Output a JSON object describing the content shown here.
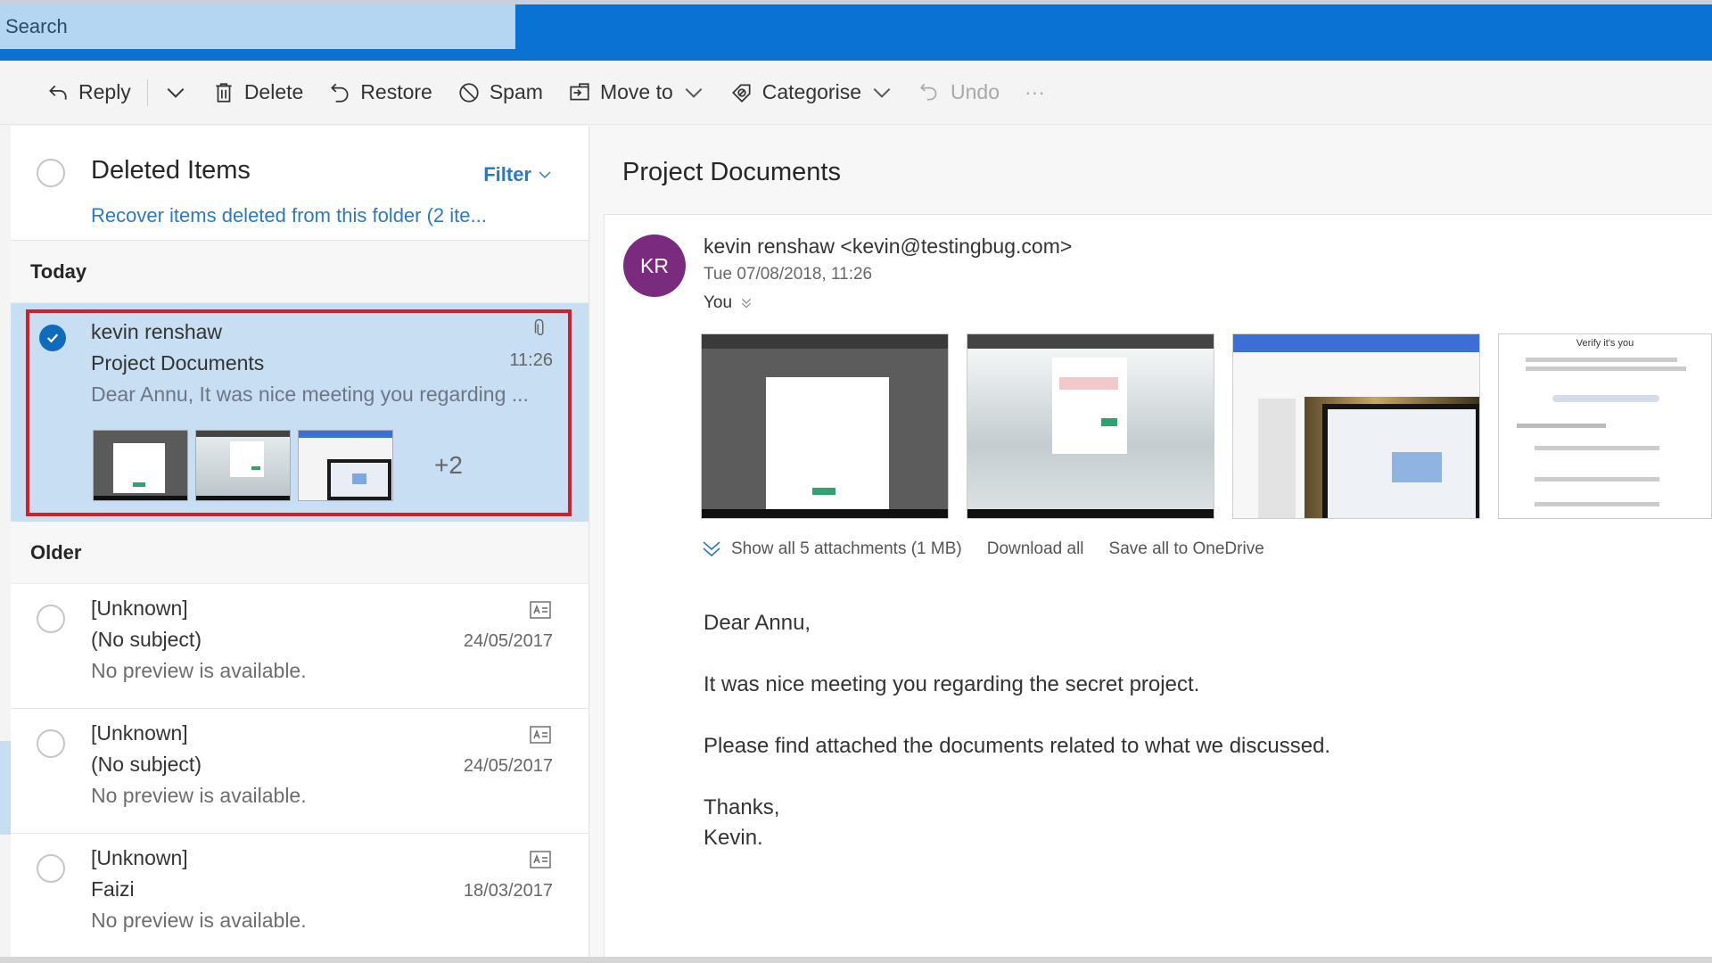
{
  "search": {
    "placeholder": "Search"
  },
  "toolbar": {
    "reply": "Reply",
    "delete": "Delete",
    "restore": "Restore",
    "spam": "Spam",
    "move_to": "Move to",
    "categorise": "Categorise",
    "undo": "Undo",
    "more": "···"
  },
  "list": {
    "folder_title": "Deleted Items",
    "filter": "Filter",
    "recover_link": "Recover items deleted from this folder (2 ite...",
    "groups": {
      "today": "Today",
      "older": "Older"
    },
    "selected": {
      "sender": "kevin renshaw",
      "subject": "Project Documents",
      "time": "11:26",
      "preview": "Dear Annu, It was nice meeting you regarding ...",
      "more_attachments": "+2",
      "has_attachment": true
    },
    "older_messages": [
      {
        "sender": "[Unknown]",
        "subject": "(No subject)",
        "date": "24/05/2017",
        "preview": "No preview is available."
      },
      {
        "sender": "[Unknown]",
        "subject": "(No subject)",
        "date": "24/05/2017",
        "preview": "No preview is available."
      },
      {
        "sender": "[Unknown]",
        "subject": "Faizi",
        "date": "18/03/2017",
        "preview": "No preview is available."
      }
    ]
  },
  "reading": {
    "title": "Project Documents",
    "avatar_initials": "KR",
    "from": "kevin renshaw <kevin@testingbug.com>",
    "date": "Tue 07/08/2018, 11:26",
    "to": "You",
    "attachments": {
      "show_all": "Show all 5 attachments (1 MB)",
      "download_all": "Download all",
      "save_all": "Save all to OneDrive",
      "thumb4_title": "Verify it's you"
    },
    "body": {
      "greeting": "Dear Annu,",
      "line1": "It was nice meeting you regarding the secret project.",
      "line2": "Please find attached the documents related to what we discussed.",
      "closing": "Thanks,",
      "signature": "Kevin."
    }
  },
  "colors": {
    "brand_blue": "#0a72d2",
    "link_blue": "#2b79c2",
    "selected_bg": "#c8def3",
    "highlight_red": "#d31f2b",
    "avatar_purple": "#7a2b7d"
  }
}
